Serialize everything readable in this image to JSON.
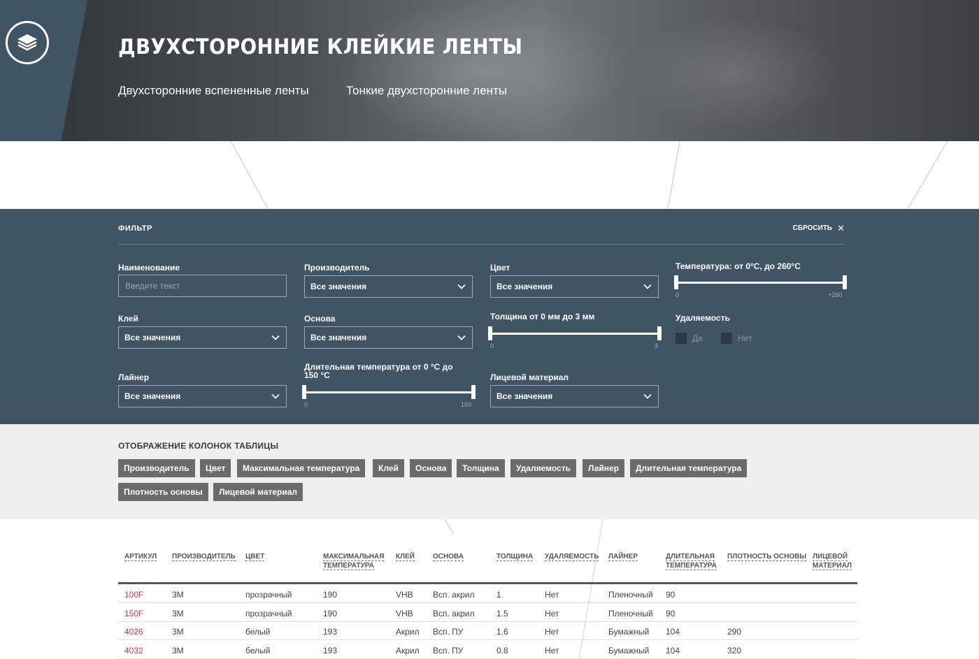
{
  "header": {
    "title": "ДВУХСТОРОННИЕ КЛЕЙКИЕ ЛЕНТЫ",
    "tabs": [
      "Двухсторонние вспененные ленты",
      "Тонкие двухсторонние ленты"
    ],
    "logo_icon": "layers-icon"
  },
  "filter": {
    "title": "ФИЛЬТР",
    "reset_label": "СБРОСИТЬ",
    "reset_icon": "close-icon",
    "name_label": "Наименование",
    "name_placeholder": "Введите текст",
    "manufacturer_label": "Производитель",
    "manufacturer_value": "Все значения",
    "color_label": "Цвет",
    "color_value": "Все значения",
    "temp_label": "Температура: от 0°C, до 260°C",
    "temp_min": "0",
    "temp_max": "+260",
    "adhesive_label": "Клей",
    "adhesive_value": "Все значения",
    "base_label": "Основа",
    "base_value": "Все значения",
    "thickness_label": "Толщина от 0 мм до 3 мм",
    "thickness_min": "0",
    "thickness_max": "3",
    "removability_label": "Удаляемость",
    "removability_yes": "Да",
    "removability_no": "Нет",
    "liner_label": "Лайнер",
    "liner_value": "Все значения",
    "longtemp_label": "Длительная температура от 0 °C до 150 °C",
    "longtemp_min": "0",
    "longtemp_max": "150",
    "face_label": "Лицевой материал",
    "face_value": "Все значения"
  },
  "columns": {
    "title": "ОТОБРАЖЕНИЕ КОЛОНОК ТАБЛИЦЫ",
    "chips": [
      "Производитель",
      "Цвет",
      "Максимальная температура",
      "Клей",
      "Основа",
      "Толщина",
      "Удаляемость",
      "Лайнер",
      "Длительная температура",
      "Плотность основы",
      "Лицевой материал"
    ]
  },
  "table": {
    "headers": [
      [
        "АРТИКУЛ"
      ],
      [
        "ПРОИЗВОДИТЕЛЬ"
      ],
      [
        "ЦВЕТ"
      ],
      [
        "МАКСИМАЛЬНАЯ",
        "ТЕМПЕРАТУРА"
      ],
      [
        "КЛЕЙ"
      ],
      [
        "ОСНОВА"
      ],
      [
        "ТОЛЩИНА"
      ],
      [
        "УДАЛЯЕМОСТЬ"
      ],
      [
        "ЛАЙНЕР"
      ],
      [
        "ДЛИТЕЛЬНАЯ",
        "ТЕМПЕРАТУРА"
      ],
      [
        "ПЛОТНОСТЬ ОСНОВЫ"
      ],
      [
        "ЛИЦЕВОЙ",
        "МАТЕРИАЛ"
      ]
    ],
    "rows": [
      [
        "100F",
        "3M",
        "прозрачный",
        "190",
        "VHB",
        "Всп. акрил",
        "1",
        "Нет",
        "Пленочный",
        "90",
        "",
        ""
      ],
      [
        "150F",
        "3M",
        "прозрачный",
        "190",
        "VHB",
        "Всп. акрил",
        "1.5",
        "Нет",
        "Пленочный",
        "90",
        "",
        ""
      ],
      [
        "4026",
        "3M",
        "белый",
        "193",
        "Акрил",
        "Всп. ПУ",
        "1.6",
        "Нет",
        "Бумажный",
        "104",
        "290",
        ""
      ],
      [
        "4032",
        "3M",
        "белый",
        "193",
        "Акрил",
        "Всп. ПУ",
        "0.8",
        "Нет",
        "Бумажный",
        "104",
        "320",
        ""
      ]
    ]
  },
  "colors": {
    "filter_bg": "#3f5564",
    "chip_bg": "#6b6b6b",
    "link": "#e53238"
  }
}
